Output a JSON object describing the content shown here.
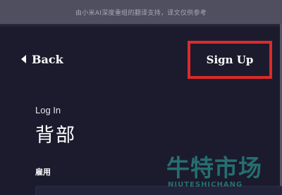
{
  "banner": {
    "text": "由小米AI深度重组的翻译支持，译文仅供参考"
  },
  "header": {
    "back_label": "Back",
    "signup_label": "Sign Up",
    "highlight_color": "#dd2a2a"
  },
  "main": {
    "login_small": "Log In",
    "title": "背部",
    "field_label": "雇用"
  },
  "watermark": {
    "cn_text": "牛特市场",
    "en_text": "NIUTESHICHANG",
    "color": "#2fb3aa"
  },
  "colors": {
    "background": "#1b1b2d",
    "banner": "#4f4f5f"
  },
  "icons": {
    "back": "triangle-left-icon"
  }
}
